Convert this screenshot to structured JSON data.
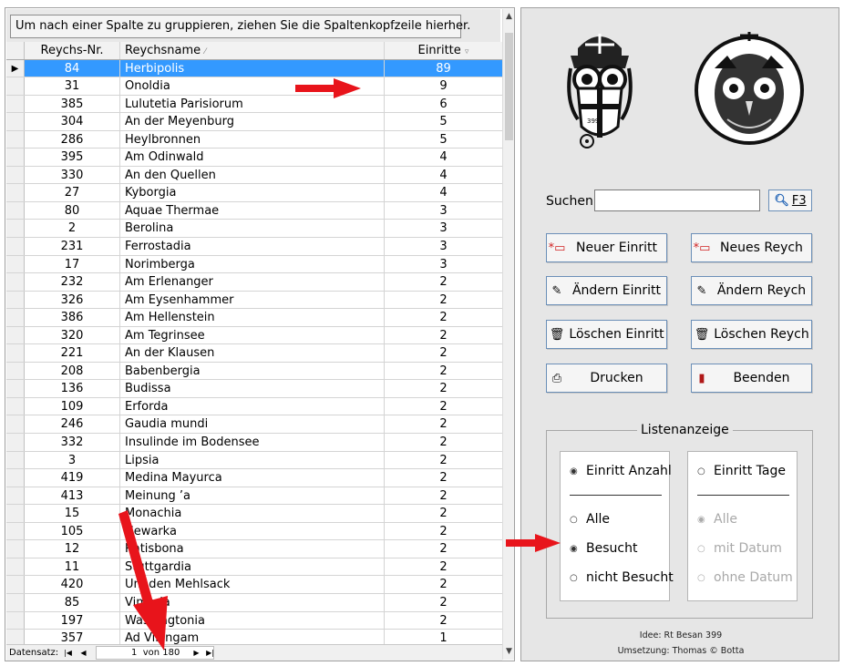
{
  "group_hint": "Um nach einer Spalte zu gruppieren, ziehen Sie die Spaltenkopfzeile hierher.",
  "grid": {
    "columns": {
      "nr": "Reychs-Nr.",
      "name": "Reychsname",
      "einritte": "Einritte"
    },
    "rows": [
      {
        "nr": "84",
        "name": "Herbipolis",
        "einritte": "89"
      },
      {
        "nr": "31",
        "name": "Onoldia",
        "einritte": "9"
      },
      {
        "nr": "385",
        "name": "Lulutetia Parisiorum",
        "einritte": "6"
      },
      {
        "nr": "304",
        "name": "An der Meyenburg",
        "einritte": "5"
      },
      {
        "nr": "286",
        "name": "Heylbronnen",
        "einritte": "5"
      },
      {
        "nr": "395",
        "name": "Am Odinwald",
        "einritte": "4"
      },
      {
        "nr": "330",
        "name": "An den Quellen",
        "einritte": "4"
      },
      {
        "nr": "27",
        "name": "Kyborgia",
        "einritte": "4"
      },
      {
        "nr": "80",
        "name": "Aquae Thermae",
        "einritte": "3"
      },
      {
        "nr": "2",
        "name": "Berolina",
        "einritte": "3"
      },
      {
        "nr": "231",
        "name": "Ferrostadia",
        "einritte": "3"
      },
      {
        "nr": "17",
        "name": "Norimberga",
        "einritte": "3"
      },
      {
        "nr": "232",
        "name": "Am Erlenanger",
        "einritte": "2"
      },
      {
        "nr": "326",
        "name": "Am Eysenhammer",
        "einritte": "2"
      },
      {
        "nr": "386",
        "name": "Am Hellenstein",
        "einritte": "2"
      },
      {
        "nr": "320",
        "name": "Am Tegrinsee",
        "einritte": "2"
      },
      {
        "nr": "221",
        "name": "An der Klausen",
        "einritte": "2"
      },
      {
        "nr": "208",
        "name": "Babenbergia",
        "einritte": "2"
      },
      {
        "nr": "136",
        "name": "Budissa",
        "einritte": "2"
      },
      {
        "nr": "109",
        "name": "Erforda",
        "einritte": "2"
      },
      {
        "nr": "246",
        "name": "Gaudia mundi",
        "einritte": "2"
      },
      {
        "nr": "332",
        "name": "Insulinde im Bodensee",
        "einritte": "2"
      },
      {
        "nr": "3",
        "name": "Lipsia",
        "einritte": "2"
      },
      {
        "nr": "419",
        "name": "Medina Mayurca",
        "einritte": "2"
      },
      {
        "nr": "413",
        "name": "Meinung ’a",
        "einritte": "2"
      },
      {
        "nr": "15",
        "name": "Monachia",
        "einritte": "2"
      },
      {
        "nr": "105",
        "name": "Newarka",
        "einritte": "2"
      },
      {
        "nr": "12",
        "name": "Ratisbona",
        "einritte": "2"
      },
      {
        "nr": "11",
        "name": "Stuttgardia",
        "einritte": "2"
      },
      {
        "nr": "420",
        "name": "Um den Mehlsack",
        "einritte": "2"
      },
      {
        "nr": "85",
        "name": "Vimaria",
        "einritte": "2"
      },
      {
        "nr": "197",
        "name": "Washingtonia",
        "einritte": "2"
      },
      {
        "nr": "357",
        "name": "Ad Villingam",
        "einritte": "1"
      }
    ]
  },
  "footer": {
    "label": "Datensatz:",
    "current": "1",
    "of_text": "von 180"
  },
  "search": {
    "label": "Suchen",
    "value": "",
    "button_label": "F3"
  },
  "buttons": {
    "neuer_einritt": "Neuer Einritt",
    "neues_reych": "Neues Reych",
    "aendern_einritt": "Ändern Einritt",
    "aendern_reych": "Ändern Reych",
    "loeschen_einritt": "Löschen Einritt",
    "loeschen_reych": "Löschen Reych",
    "drucken": "Drucken",
    "beenden": "Beenden"
  },
  "listenanzeige": {
    "title": "Listenanzeige",
    "left": {
      "top_option": "Einritt Anzahl",
      "options": [
        "Alle",
        "Besucht",
        "nicht Besucht"
      ],
      "selected_top": true,
      "selected_index": 1
    },
    "right": {
      "top_option": "Einritt Tage",
      "options": [
        "Alle",
        "mit Datum",
        "ohne Datum"
      ],
      "selected_index": 0
    }
  },
  "credits": {
    "idea": "Idee: Rt Besan 399",
    "impl": "Umsetzung: Thomas © Botta"
  },
  "colors": {
    "selection": "#3399ff",
    "arrow": "#e8141b",
    "button_border": "#6b8fb8",
    "panel_bg": "#e6e6e6"
  },
  "icons": [
    "new-record-icon",
    "edit-pencil-icon",
    "trash-icon",
    "printer-icon",
    "exit-door-icon",
    "search-icon"
  ]
}
